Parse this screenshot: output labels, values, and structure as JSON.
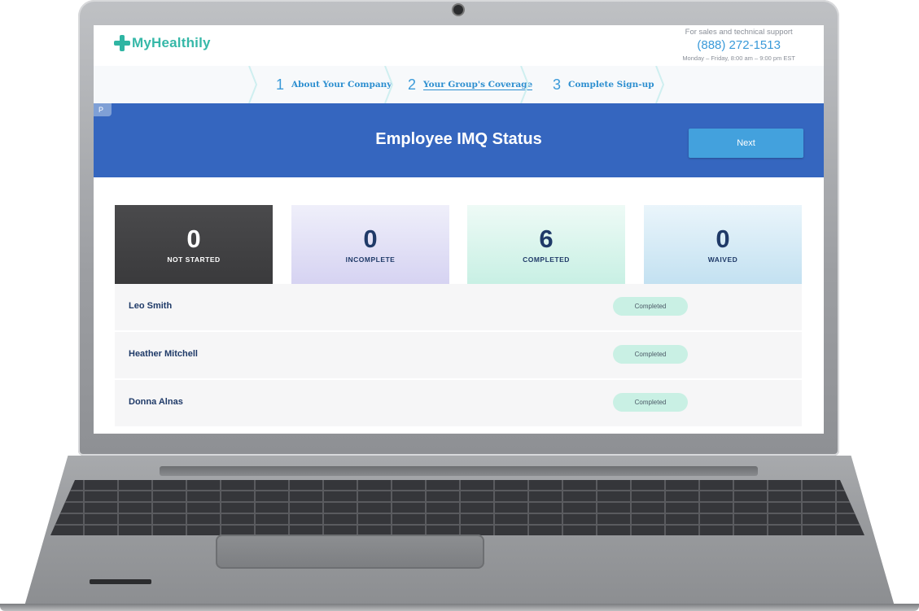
{
  "brand": {
    "name": "MyHealthily",
    "accent": "#36b8a8"
  },
  "support": {
    "label": "For sales and technical support",
    "phone": "(888) 272-1513",
    "hours": "Monday – Friday, 8:00 am – 9:00 pm EST"
  },
  "steps": [
    {
      "number": "1",
      "label": "About Your Company"
    },
    {
      "number": "2",
      "label": "Your Group's Coverage"
    },
    {
      "number": "3",
      "label": "Complete Sign-up"
    }
  ],
  "header": {
    "title": "Employee IMQ Status",
    "next_label": "Next",
    "side_tab": "P",
    "color": "#3566bf"
  },
  "summary": [
    {
      "count": "0",
      "label": "NOT STARTED"
    },
    {
      "count": "0",
      "label": "INCOMPLETE"
    },
    {
      "count": "6",
      "label": "COMPLETED"
    },
    {
      "count": "0",
      "label": "WAIVED"
    }
  ],
  "employees": [
    {
      "name": "Leo Smith",
      "status": "Completed"
    },
    {
      "name": "Heather Mitchell",
      "status": "Completed"
    },
    {
      "name": "Donna Alnas",
      "status": "Completed"
    }
  ]
}
